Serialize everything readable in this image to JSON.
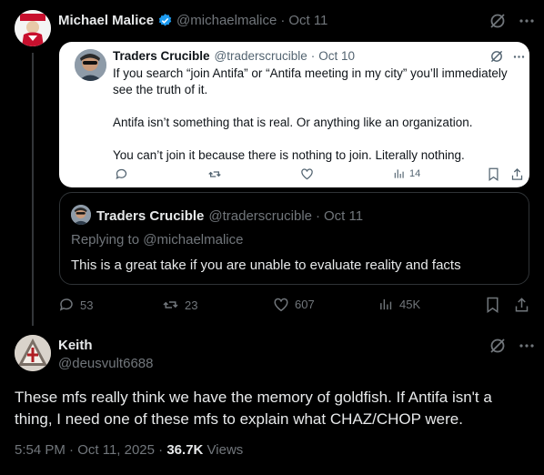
{
  "quoting_post": {
    "author_name": "Michael Malice",
    "handle": "@michaelmalice",
    "dot": "·",
    "date": "Oct 11",
    "avatar_icon": "red-portrait-avatar"
  },
  "quoted_post": {
    "author_name": "Traders Crucible",
    "handle": "@traderscrucible",
    "dot": "·",
    "date": "Oct 10",
    "paragraphs": [
      "If you search “join Antifa” or “Antifa meeting in my city” you’ll immediately see the truth of it.",
      "Antifa isn’t something that is real. Or anything like an organization.",
      "You can’t join it because there is nothing to join. Literally nothing."
    ],
    "views": "14"
  },
  "reply_card": {
    "author_name": "Traders Crucible",
    "handle": "@traderscrucible",
    "dot": "·",
    "date": "Oct 11",
    "replying_to": "Replying to @michaelmalice",
    "text": "This is a great take if you are unable to evaluate reality and facts"
  },
  "post_actions": {
    "replies": "53",
    "reposts": "23",
    "likes": "607",
    "views": "45K"
  },
  "main_post": {
    "author_name": "Keith",
    "handle": "@deusvult6688",
    "text": "These mfs really think we have the memory of goldfish. If Antifa isn't a thing, I need one of these mfs to explain what CHAZ/CHOP were.",
    "time": "5:54 PM",
    "dot": "·",
    "date": "Oct 11, 2025",
    "dot2": "·",
    "views_count": "36.7K",
    "views_label": "Views"
  },
  "colors": {
    "background": "#000000",
    "text": "#e7e9ea",
    "muted": "#71767b",
    "verified": "#1d9bf0",
    "border": "#2f3336",
    "card_bg": "#ffffff"
  }
}
